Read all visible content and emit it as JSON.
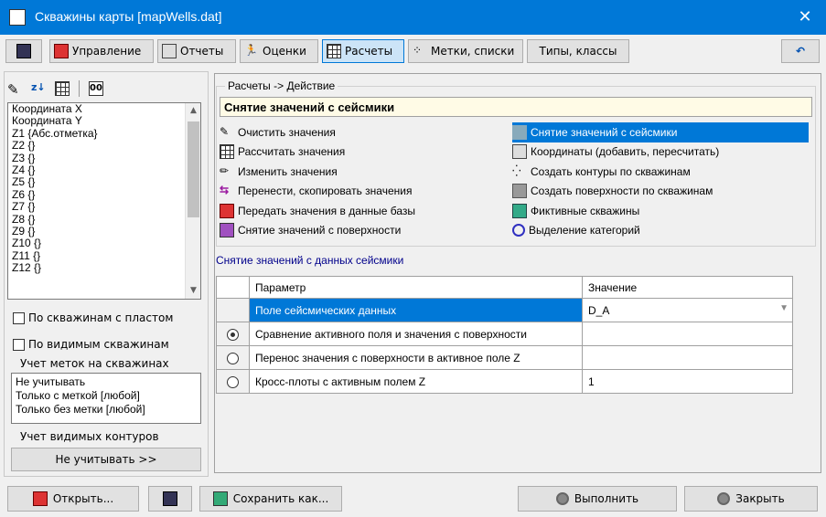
{
  "window": {
    "title": "Скважины карты [mapWells.dat]",
    "close": "✕"
  },
  "toolbar": {
    "tabs": [
      "Управление",
      "Отчеты",
      "Оценки",
      "Расчеты",
      "Метки, списки",
      "Типы, классы"
    ],
    "active": "Расчеты",
    "undo": "↶"
  },
  "left": {
    "icon_text": "00",
    "fields": [
      "Координата X",
      "Координата Y",
      "Z1 {Абс.отметка}",
      "Z2 {}",
      "Z3 {}",
      "Z4 {}",
      "Z5 {}",
      "Z6 {}",
      "Z7 {}",
      "Z8 {}",
      "Z9 {}",
      "Z10 {}",
      "Z11 {}",
      "Z12 {}"
    ],
    "chk1": "По скважинам с пластом",
    "chk2": "По видимым скважинам",
    "marks_label": "Учет меток на скважинах",
    "marks": [
      "Не учитывать",
      "Только с меткой   [любой]",
      "Только без метки [любой]"
    ],
    "contours_label": "Учет видимых контуров",
    "contours_button": "Не учитывать  >>"
  },
  "right": {
    "group_label": "Расчеты -> Действие",
    "selected_action": "Снятие значений с сейсмики",
    "actions_left": [
      "Очистить значения",
      "Рассчитать значения",
      "Изменить значения",
      "Перенести, скопировать значения",
      "Передать значения в данные базы",
      "Снятие значений с поверхности"
    ],
    "actions_right": [
      "Снятие значений с сейсмики",
      "Координаты (добавить, пересчитать)",
      "Создать контуры по скважинам",
      "Создать поверхности по скважинам",
      "Фиктивные скважины",
      "Выделение категорий"
    ],
    "subtitle": "Снятие значений с данных сейсмики",
    "grid_headers": [
      "Параметр",
      "Значение"
    ],
    "rows": [
      {
        "param": "Поле сейсмических данных",
        "value": "D_A"
      },
      {
        "param": "Сравнение активного поля и значения с поверхности",
        "value": ""
      },
      {
        "param": "Перенос значения с поверхности в активное поле Z",
        "value": ""
      },
      {
        "param": "Кросс-плоты с активным полем Z",
        "value": "1"
      }
    ]
  },
  "bottom": {
    "open": "Открыть...",
    "save_as": "Сохранить как...",
    "run": "Выполнить",
    "close": "Закрыть"
  }
}
